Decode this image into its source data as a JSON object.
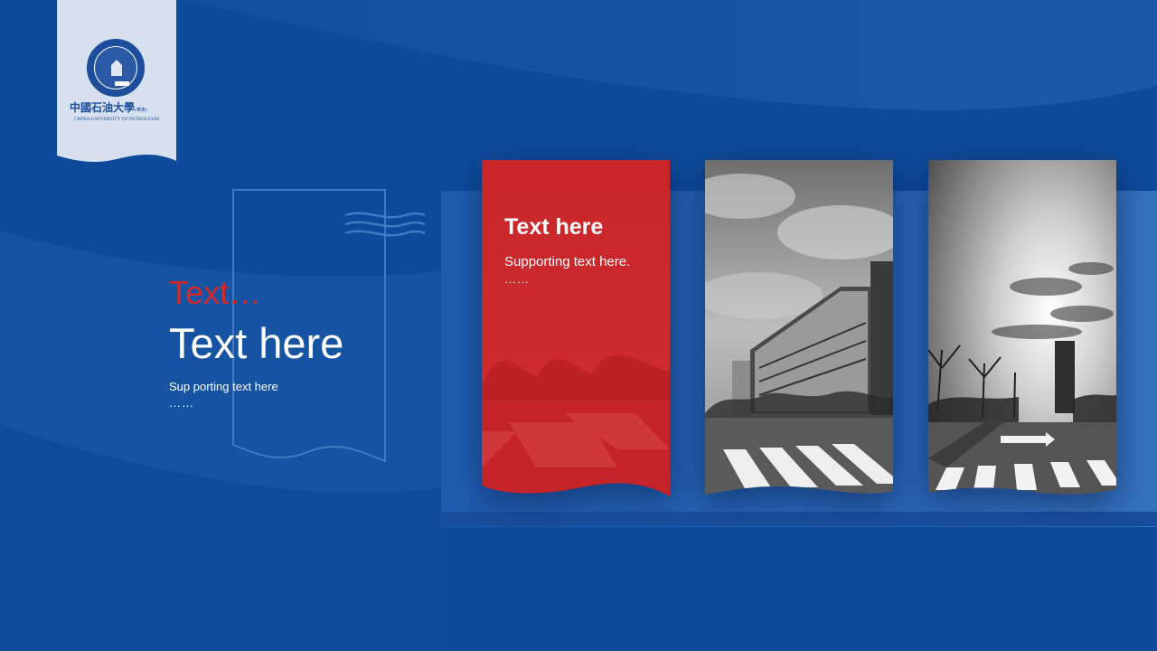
{
  "colors": {
    "background": "#0d4a99",
    "accent_red": "#d0292c",
    "logo_tab": "#d6e0ee",
    "brand_blue": "#1d4e9b"
  },
  "logo": {
    "name_cn": "中國石油大學",
    "campus_tag": "(華東)",
    "name_en": "CHINA UNIVERSITY OF PETROLEUM",
    "seal_ring_text": "CHINA UNIVERSITY OF PETROLEUM",
    "seal_year": "1953"
  },
  "left_block": {
    "label": "Text…",
    "title": "Text here",
    "subtitle": "Sup porting text here",
    "ellipsis": "……"
  },
  "cards": [
    {
      "title": "Text here",
      "text": "Supporting text here.",
      "ellipsis": "……",
      "image": "campus-road-photo-red-tint"
    },
    {
      "image": "campus-building-photo-bw"
    },
    {
      "image": "sunburst-street-photo-bw"
    }
  ]
}
